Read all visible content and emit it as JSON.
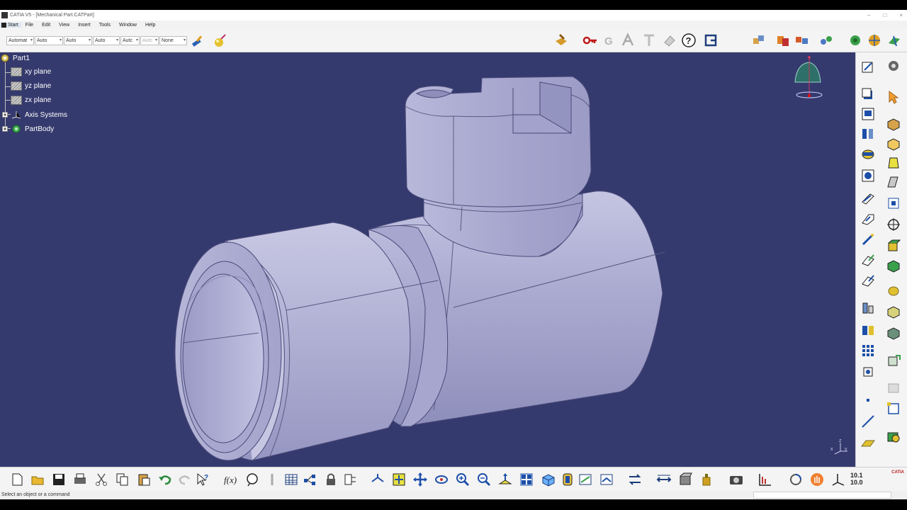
{
  "window": {
    "title": "CATIA V5 - [Mechanical Part.CATPart]",
    "min": "–",
    "max": "□",
    "close": "×"
  },
  "menu": [
    "Start",
    "File",
    "Edit",
    "View",
    "Insert",
    "Tools",
    "Window",
    "Help"
  ],
  "toolbar": {
    "combos": [
      "Automat",
      "Auto",
      "Auto",
      "Auto",
      "Autc",
      "Autc",
      "None"
    ],
    "icons": [
      "painter-brush-icon",
      "magic-wand-icon",
      "publish-icon",
      "key-icon",
      "geometrical-set-icon",
      "text-annotation-icon",
      "eraser-icon",
      "help-icon",
      "logo-icon",
      "shapes-icon",
      "catalog-icon",
      "multi-part-icon",
      "link-icon",
      "plane-icon",
      "settings-icon",
      "globe-icon"
    ]
  },
  "tree": {
    "root": "Part1",
    "items": [
      "xy plane",
      "yz plane",
      "zx plane",
      "Axis Systems",
      "PartBody"
    ]
  },
  "compass": {
    "x": "x",
    "y": "y",
    "z": "z"
  },
  "status": {
    "message": "Select an object or a command"
  },
  "bottom_readout": {
    "line1": "10.1",
    "line2": "10.0"
  },
  "logo_text": "CATIA",
  "colors": {
    "viewport": "#353a6e",
    "part": "#b2b2d6",
    "toolbar": "#f4f4f4"
  }
}
